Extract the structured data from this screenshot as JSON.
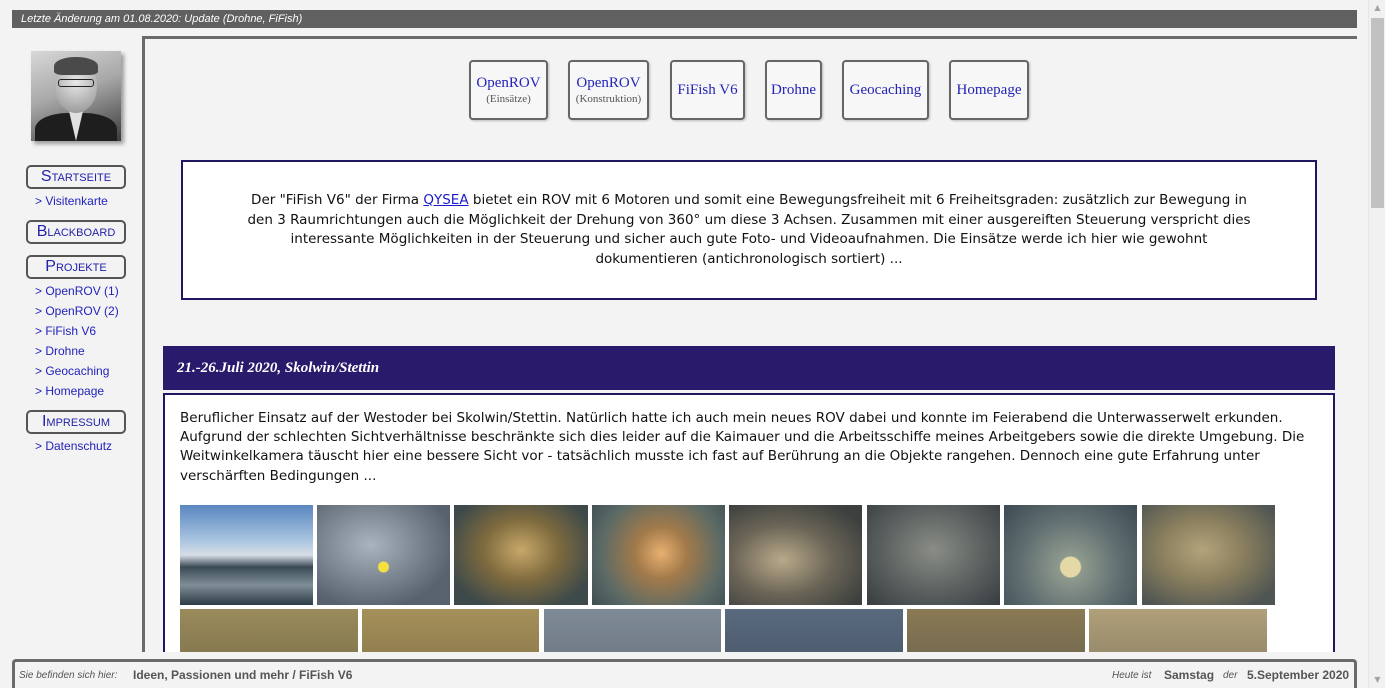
{
  "top_bar": {
    "text": "Letzte Änderung am 01.08.2020: Update (Drohne, FiFish)"
  },
  "sidebar": {
    "avatar_icon": "portrait-photo",
    "nav": [
      {
        "label": "Startseite",
        "children": [
          "> Visitenkarte"
        ]
      },
      {
        "label": "Blackboard",
        "children": []
      },
      {
        "label": "Projekte",
        "children": [
          "> OpenROV (1)",
          "> OpenROV (2)",
          "> FiFish V6",
          "> Drohne",
          "> Geocaching",
          "> Homepage"
        ]
      },
      {
        "label": "Impressum",
        "children": [
          "> Datenschutz"
        ]
      }
    ]
  },
  "project_buttons": [
    {
      "label": "OpenROV",
      "sub": "(Einsätze)"
    },
    {
      "label": "OpenROV",
      "sub": "(Konstruktion)"
    },
    {
      "label": "FiFish V6",
      "sub": ""
    },
    {
      "label": "Drohne",
      "sub": ""
    },
    {
      "label": "Geocaching",
      "sub": ""
    },
    {
      "label": "Homepage",
      "sub": ""
    }
  ],
  "intro": {
    "before_link": "Der \"FiFish V6\" der Firma ",
    "link": "QYSEA",
    "after_link": " bietet ein ROV mit 6 Motoren und somit eine Bewegungsfreiheit mit 6 Freiheitsgraden: zusätzlich zur Bewegung in den 3 Raumrichtungen auch die Möglichkeit der Drehung von 360° um diese 3 Achsen. Zusammen mit einer ausgereiften Steuerung verspricht dies interessante Möglichkeiten in der Steuerung und sicher auch gute Foto- und Videoaufnahmen. Die Einsätze werde ich hier wie gewohnt dokumentieren (antichronologisch sortiert) ..."
  },
  "entry": {
    "title": "21.-26.Juli 2020, Skolwin/Stettin",
    "text": "Beruflicher Einsatz auf der Westoder bei Skolwin/Stettin. Natürlich hatte ich auch mein neues ROV dabei und konnte im Feierabend die Unterwasserwelt erkunden. Aufgrund der schlechten Sichtverhältnisse beschränkte sich dies leider auf die Kaimauer und die Arbeitsschiffe meines Arbeitgebers sowie die direkte Umgebung. Die Weitwinkelkamera täuscht hier eine bessere Sicht vor - tatsächlich musste ich fast auf Berührung an die Objekte rangehen. Dennoch eine gute Erfahrung unter verschärften Bedingungen ...",
    "thumbnails_row1": [
      "harbor-photo",
      "water-surface-photo",
      "underwater-photo",
      "underwater-photo",
      "underwater-photo",
      "underwater-photo",
      "underwater-photo",
      "underwater-photo"
    ],
    "thumbnails_row2": [
      "underwater-photo",
      "underwater-photo",
      "underwater-photo",
      "underwater-photo",
      "underwater-photo",
      "underwater-photo"
    ]
  },
  "footer": {
    "location_label": "Sie befinden sich hier:",
    "location_path": "Ideen, Passionen und mehr / FiFish V6",
    "today_label": "Heute ist",
    "weekday": "Samstag",
    "der_label": "der",
    "date": "5.September 2020"
  },
  "colors": {
    "accent_dark_blue": "#2a1a6b",
    "link_blue": "#2222aa",
    "top_bar": "#606060"
  }
}
